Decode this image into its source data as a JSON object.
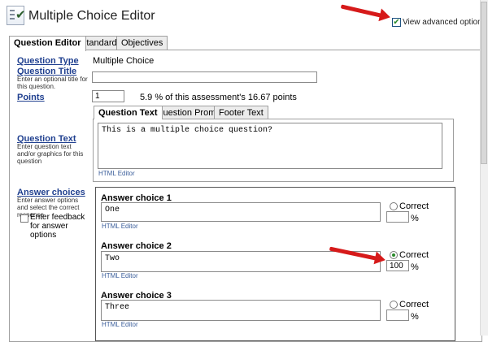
{
  "header": {
    "title": "Multiple Choice Editor",
    "advanced_label": "View advanced options",
    "advanced_checked": true
  },
  "tabs": [
    {
      "label": "Question Editor",
      "active": true
    },
    {
      "label": "Standards",
      "active": false
    },
    {
      "label": "Objectives",
      "active": false
    }
  ],
  "form": {
    "question_type": {
      "label": "Question Type",
      "value": "Multiple Choice"
    },
    "question_title": {
      "label": "Question Title",
      "hint": "Enter an optional title for this question.",
      "value": ""
    },
    "points": {
      "label": "Points",
      "value": "1",
      "summary": "5.9 % of this assessment's 16.67 points"
    },
    "question_text": {
      "label": "Question Text",
      "hint": "Enter question text and/or graphics for this question",
      "value": "This is a multiple choice question?",
      "editor_link": "HTML Editor"
    },
    "subtabs": [
      {
        "label": "Question Text",
        "active": true
      },
      {
        "label": "Question Prompt",
        "active": false
      },
      {
        "label": "Footer Text",
        "active": false
      }
    ],
    "answer_choices": {
      "label": "Answer choices",
      "hint": "Enter answer options and select the correct response",
      "feedback_label": "Enter feedback for answer options",
      "feedback_checked": false
    }
  },
  "answers": [
    {
      "title": "Answer choice 1",
      "text": "One",
      "editor_link": "HTML Editor",
      "correct_label": "Correct",
      "correct": false,
      "percent": "",
      "percent_sign": "%"
    },
    {
      "title": "Answer choice 2",
      "text": "Two",
      "editor_link": "HTML Editor",
      "correct_label": "Correct",
      "correct": true,
      "percent": "100",
      "percent_sign": "%"
    },
    {
      "title": "Answer choice 3",
      "text": "Three",
      "editor_link": "HTML Editor",
      "correct_label": "Correct",
      "correct": false,
      "percent": "",
      "percent_sign": "%"
    }
  ],
  "colors": {
    "link_blue": "#1f3f8f",
    "annotation_red": "#d61a1a",
    "selected_green": "#2a8a2a"
  },
  "icons": {
    "app": "checklist-icon",
    "advanced_checkbox": "checkmark-icon"
  }
}
